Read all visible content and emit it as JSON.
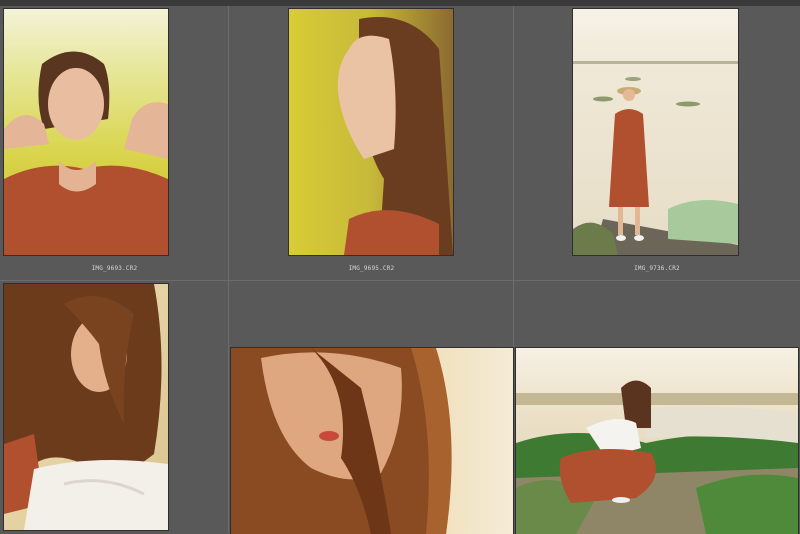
{
  "cells": [
    {
      "filename": "IMG_9693.CR2"
    },
    {
      "filename": "IMG_9695.CR2"
    },
    {
      "filename": "IMG_9736.CR2"
    },
    {
      "filename": ""
    },
    {
      "filename": ""
    },
    {
      "filename": ""
    }
  ],
  "colors": {
    "background": "#595959",
    "separator": "#6c6c6c",
    "caption": "#d8d8d8",
    "dress": "#b0502e"
  }
}
